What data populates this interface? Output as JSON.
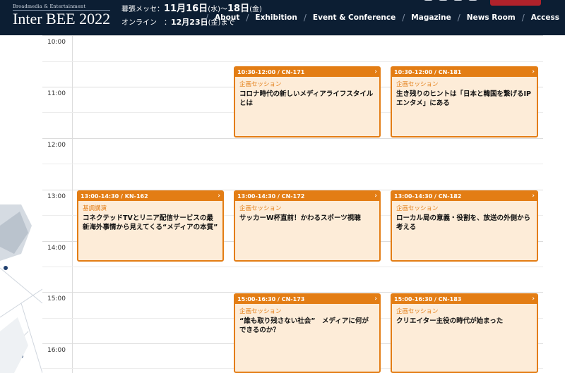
{
  "header": {
    "logo_small": "Broadmedia & Entertainment",
    "logo_main": "Inter BEE 2022",
    "venue_line": {
      "label": "幕張メッセ：",
      "date_start": "11月16日",
      "day_start": "(水)",
      "sep": "〜",
      "date_end": "18日",
      "day_end": "(金)"
    },
    "online_line": {
      "label": "オンライン　：",
      "date": "12月23日",
      "day": "(金)",
      "suffix": "まで"
    },
    "nav": [
      {
        "label": "About"
      },
      {
        "label": "Exhibition"
      },
      {
        "label": "Event & Conference"
      },
      {
        "label": "Magazine"
      },
      {
        "label": "News Room"
      },
      {
        "label": "Access"
      }
    ]
  },
  "schedule": {
    "times": [
      "10:00",
      "11:00",
      "12:00",
      "13:00",
      "14:00",
      "15:00",
      "16:00"
    ],
    "sessions": [
      {
        "head": "10:30-12:00 / CN-171",
        "category": "企画セッション",
        "title": "コロナ時代の新しいメディアライフスタイルとは"
      },
      {
        "head": "10:30-12:00 / CN-181",
        "category": "企画セッション",
        "title": "生き残りのヒントは「日本と韓国を繋げるIPエンタメ」にある"
      },
      {
        "head": "13:00-14:30 / KN-162",
        "category": "基調講演",
        "title": "コネクテッドTVとリニア配信サービスの最新海外事情から見えてくる“メディアの本質”"
      },
      {
        "head": "13:00-14:30 / CN-172",
        "category": "企画セッション",
        "title": "サッカーW杯直前！かわるスポーツ視聴"
      },
      {
        "head": "13:00-14:30 / CN-182",
        "category": "企画セッション",
        "title": "ローカル局の意義・役割を、放送の外側から考える"
      },
      {
        "head": "15:00-16:30 / CN-173",
        "category": "企画セッション",
        "title": "“誰も取り残さない社会”　メディアに何ができるのか？"
      },
      {
        "head": "15:00-16:30 / CN-183",
        "category": "企画セッション",
        "title": "クリエイター主役の時代が始まった"
      }
    ]
  },
  "icons": {
    "chevron": "›"
  },
  "colors": {
    "header_bg": "#0c1e33",
    "accent": "#e37d14",
    "card_bg": "#fdecd8"
  }
}
